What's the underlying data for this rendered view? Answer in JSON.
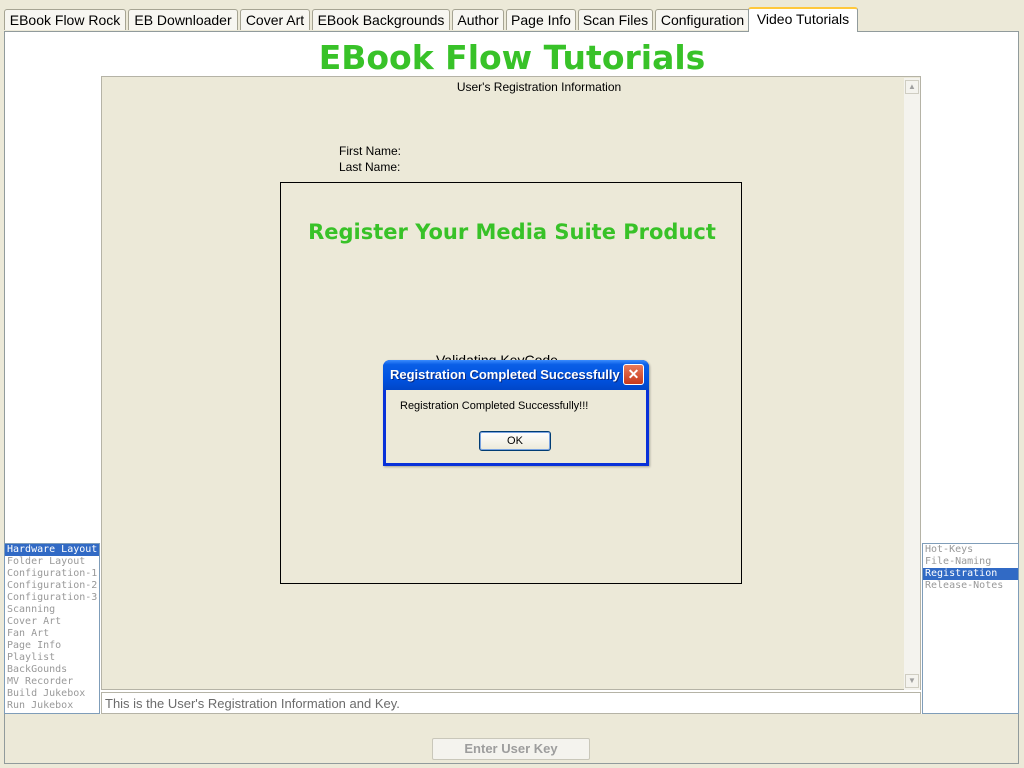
{
  "tabs": [
    {
      "label": "EBook Flow Rock"
    },
    {
      "label": "EB Downloader"
    },
    {
      "label": "Cover Art"
    },
    {
      "label": "EBook Backgrounds"
    },
    {
      "label": "Author"
    },
    {
      "label": "Page Info"
    },
    {
      "label": "Scan Files"
    },
    {
      "label": "Configuration"
    },
    {
      "label": "Video Tutorials",
      "active": true
    }
  ],
  "page_title": "EBook Flow Tutorials",
  "registration": {
    "header": "User's Registration Information",
    "first_name_label": "First Name:",
    "last_name_label": "Last  Name:"
  },
  "register_panel": {
    "title": "Register Your Media Suite Product",
    "validating": "Validating KeyCode"
  },
  "dialog": {
    "title": "Registration Completed Successfully",
    "message": "Registration Completed Successfully!!!",
    "ok_label": "OK",
    "close_icon": "close-icon"
  },
  "left_list": {
    "items": [
      "Hardware Layout",
      "Folder Layout",
      "Configuration-1",
      "Configuration-2",
      "Configuration-3",
      "Scanning",
      "Cover Art",
      "Fan Art",
      "Page Info",
      "Playlist",
      "BackGounds",
      "MV Recorder",
      "Build Jukebox",
      "Run Jukebox"
    ],
    "selected": "Hardware Layout"
  },
  "right_list": {
    "items": [
      "Hot-Keys",
      "File-Naming",
      "Registration",
      "Release-Notes"
    ],
    "selected": "Registration"
  },
  "status_text": "This is the User's Registration Information and Key.",
  "enter_user_key_label": "Enter User Key",
  "colors": {
    "title_green": "#38c228",
    "selection_blue": "#316ac5",
    "dialog_blue": "#0831d9",
    "active_tab_accent": "#ffc83c"
  }
}
